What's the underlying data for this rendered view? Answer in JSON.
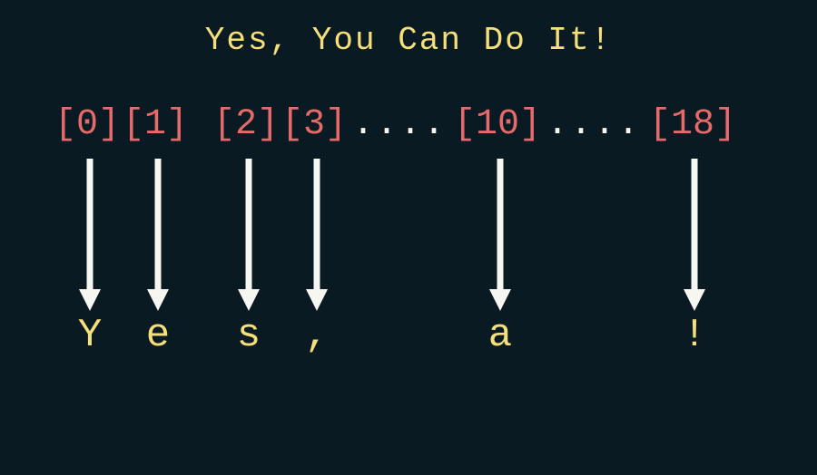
{
  "title": "Yes, You Can Do It!",
  "indices": {
    "i0": "[0]",
    "i1": "[1]",
    "i2": "[2]",
    "i3": "[3]",
    "i10": "[10]",
    "i18": "[18]"
  },
  "dots1": "....",
  "dots2": "....",
  "chars": {
    "c0": "Y",
    "c1": "e",
    "c2": "s",
    "c3": ",",
    "c10": "a",
    "c18": "!"
  }
}
